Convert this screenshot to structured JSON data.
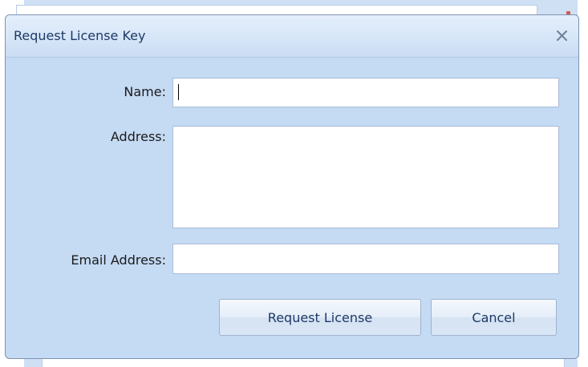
{
  "dialog": {
    "title": "Request License Key",
    "close_icon": "close-icon"
  },
  "form": {
    "name_label": "Name:",
    "name_value": "",
    "address_label": "Address:",
    "address_value": "",
    "email_label": "Email Address:",
    "email_value": ""
  },
  "buttons": {
    "request_label": "Request License",
    "cancel_label": "Cancel"
  },
  "colors": {
    "dialog_background": "#c5daf3",
    "title_text": "#1e3a66",
    "button_text": "#1f3a66"
  }
}
